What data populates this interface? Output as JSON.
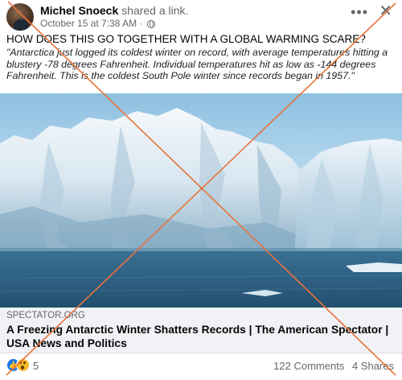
{
  "post": {
    "author": "Michel Snoeck",
    "action": "shared a link.",
    "timestamp": "October 15 at 7:38 AM",
    "dot": "·",
    "headline": "HOW DOES THIS GO TOGETHER WITH A GLOBAL WARMING SCARE?",
    "quote": "\"Antarctica just logged its coldest winter on record, with average temperatures hitting a blustery -78 degrees Fahrenheit. Individual temperatures hit as low as -144 degrees Fahrenheit. This is the coldest South Pole winter since records began in 1957.\""
  },
  "header_icons": {
    "more": "more-options-icon",
    "more_glyph": "•••",
    "close": "close-icon",
    "close_glyph": "✕",
    "privacy": "globe-icon"
  },
  "link": {
    "domain": "SPECTATOR.ORG",
    "title": "A Freezing Antarctic Winter Shatters Records | The American Spectator | USA News and Politics",
    "image": "iceberg-image"
  },
  "engagement": {
    "reaction_count": "5",
    "comments": "122 Comments",
    "shares": "4 Shares",
    "reactions": [
      "like-icon",
      "wow-icon"
    ]
  },
  "colors": {
    "overlay_cross": "#e8733a",
    "link_footer_bg": "#f0f2f5",
    "like_blue": "#1877f2"
  }
}
